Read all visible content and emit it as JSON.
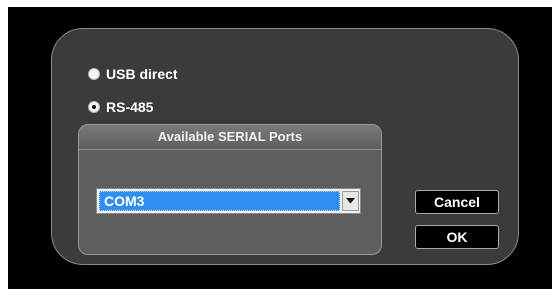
{
  "connection": {
    "options": [
      {
        "label": "USB direct",
        "selected": false
      },
      {
        "label": "RS-485",
        "selected": true
      }
    ]
  },
  "ports": {
    "title": "Available SERIAL Ports",
    "selected_value": "COM3"
  },
  "buttons": {
    "cancel": "Cancel",
    "ok": "OK"
  },
  "colors": {
    "dialog_bg": "#3b3b3b",
    "selection": "#2f8ef0",
    "frame": "#000000"
  },
  "icons": {
    "dropdown": "chevron-down-icon"
  }
}
